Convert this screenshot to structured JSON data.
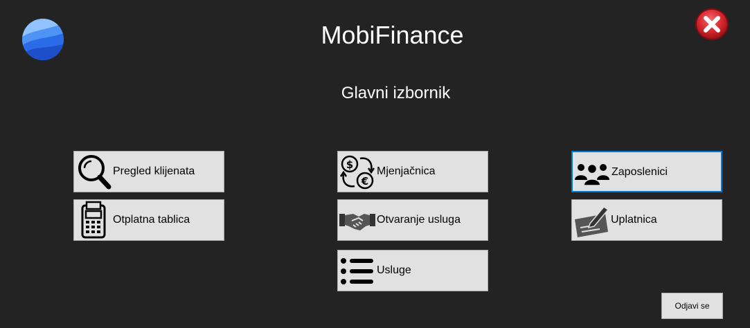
{
  "window": {
    "title": "MobiFinance",
    "subtitle": "Glavni izbornik",
    "logo_icon": "globe-logo-icon",
    "close_icon": "red-close-icon"
  },
  "menu": {
    "pregled_klijenata": {
      "label": "Pregled klijenata",
      "icon": "magnifier-icon"
    },
    "otplatna_tablica": {
      "label": "Otplatna tablica",
      "icon": "calculator-icon"
    },
    "mjenjacnica": {
      "label": "Mjenjačnica",
      "icon": "currency-exchange-icon"
    },
    "otvaranje_usluga": {
      "label": "Otvaranje usluga",
      "icon": "handshake-icon"
    },
    "usluge": {
      "label": "Usluge",
      "icon": "list-icon"
    },
    "zaposlenici": {
      "label": "Zaposlenici",
      "icon": "people-icon"
    },
    "uplatnica": {
      "label": "Uplatnica",
      "icon": "signed-form-icon"
    }
  },
  "logout": {
    "label": "Odjavi se"
  },
  "colors": {
    "background": "#242323",
    "tile": "#e1e1e1",
    "selected_border": "#0078d7",
    "close_red": "#d4242c"
  }
}
